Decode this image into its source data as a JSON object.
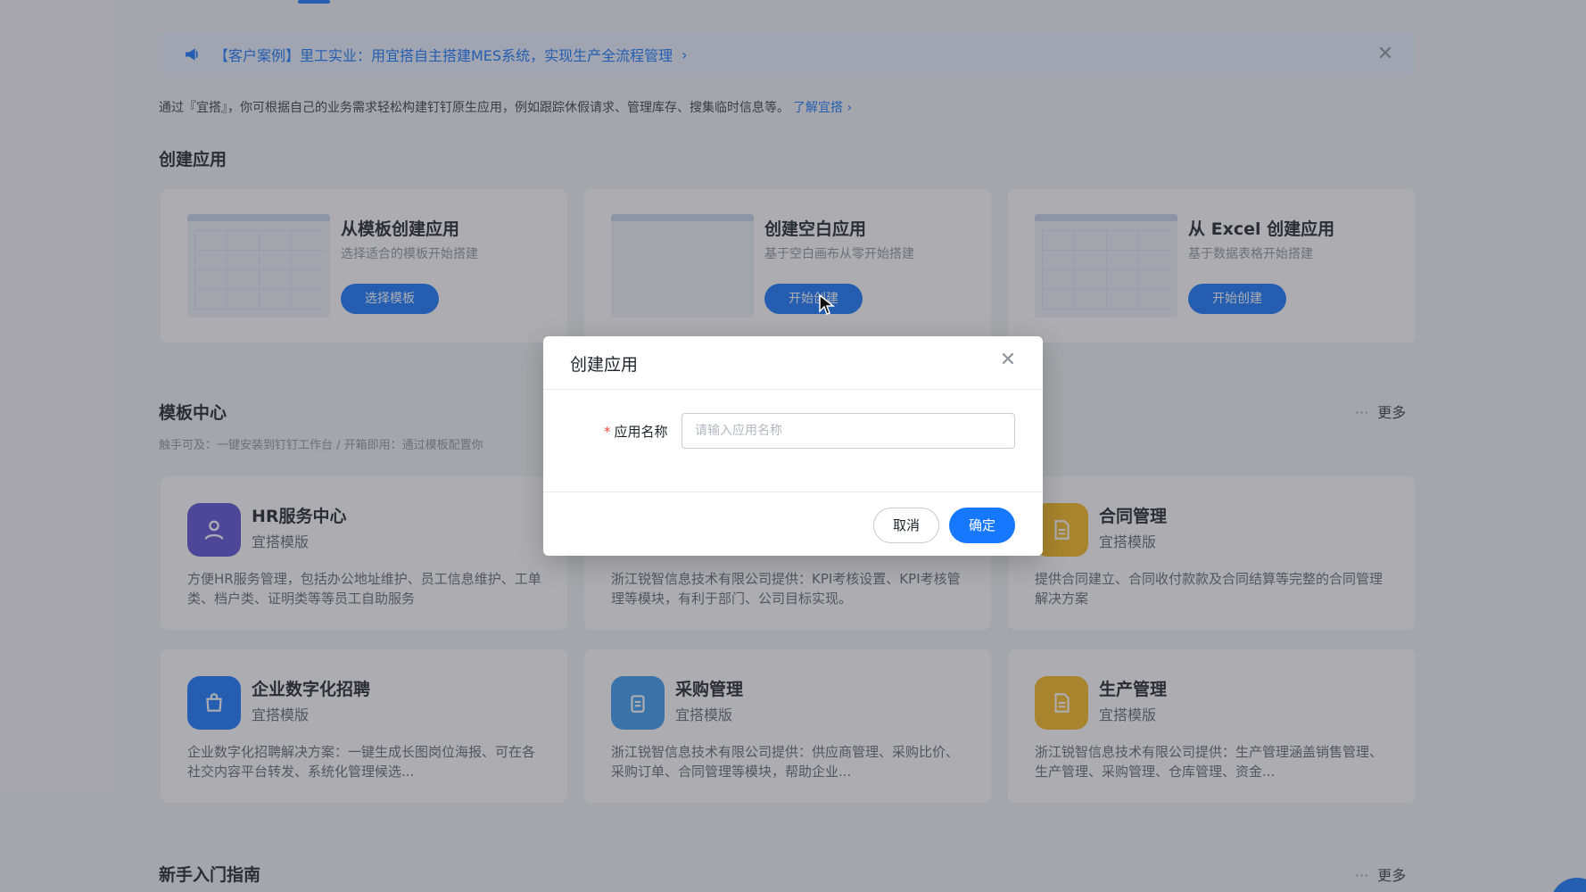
{
  "banner": {
    "text": "【客户案例】里工实业：用宜搭自主搭建MES系统，实现生产全流程管理",
    "chevron": "›",
    "close": "✕"
  },
  "intro": {
    "text": "通过『宜搭』，你可根据自己的业务需求轻松构建钉钉原生应用，例如跟踪休假请求、管理库存、搜集临时信息等。",
    "link": "了解宜搭 ›"
  },
  "create_section": {
    "title": "创建应用",
    "cards": [
      {
        "title": "从模板创建应用",
        "subtitle": "选择适合的模板开始搭建",
        "button": "选择模板"
      },
      {
        "title": "创建空白应用",
        "subtitle": "基于空白画布从零开始搭建",
        "button": "开始创建"
      },
      {
        "title": "从 Excel 创建应用",
        "subtitle": "基于数据表格开始搭建",
        "button": "开始创建"
      }
    ]
  },
  "template_section": {
    "title": "模板中心",
    "more_dots": "···",
    "more": "更多",
    "hint": "触手可及：一键安装到钉钉工作台 / 开箱即用：通过模板配置你"
  },
  "templates": [
    {
      "name": "HR服务中心",
      "tag": "宜搭模版",
      "desc": "方便HR服务管理，包括办公地址维护、员工信息维护、工单类、档户类、证明类等等员工自助服务",
      "color": "#5b4fd6"
    },
    {
      "name": "",
      "tag": "",
      "desc": "浙江锐智信息技术有限公司提供：KPI考核设置、KPI考核管理等模块，有利于部门、公司目标实现。",
      "color": "#3b82f6"
    },
    {
      "name": "合同管理",
      "tag": "宜搭模版",
      "desc": "提供合同建立、合同收付款款及合同结算等完整的合同管理解决方案",
      "color": "#f5b81c"
    },
    {
      "name": "企业数字化招聘",
      "tag": "宜搭模版",
      "desc": "企业数字化招聘解决方案：一键生成长图岗位海报、可在各社交内容平台转发、系统化管理候选...",
      "color": "#1677ff"
    },
    {
      "name": "采购管理",
      "tag": "宜搭模版",
      "desc": "浙江锐智信息技术有限公司提供：供应商管理、采购比价、采购订单、合同管理等模块，帮助企业...",
      "color": "#3b9bf0"
    },
    {
      "name": "生产管理",
      "tag": "宜搭模版",
      "desc": "浙江锐智信息技术有限公司提供：生产管理涵盖销售管理、生产管理、采购管理、仓库管理、资金...",
      "color": "#f5b81c"
    }
  ],
  "guide_section": {
    "title": "新手入门指南",
    "more_dots": "···",
    "more": "更多"
  },
  "modal": {
    "title": "创建应用",
    "close": "✕",
    "required_mark": "*",
    "field_label": "应用名称",
    "field_value": "",
    "field_placeholder": "请输入应用名称",
    "cancel": "取消",
    "confirm": "确定"
  }
}
